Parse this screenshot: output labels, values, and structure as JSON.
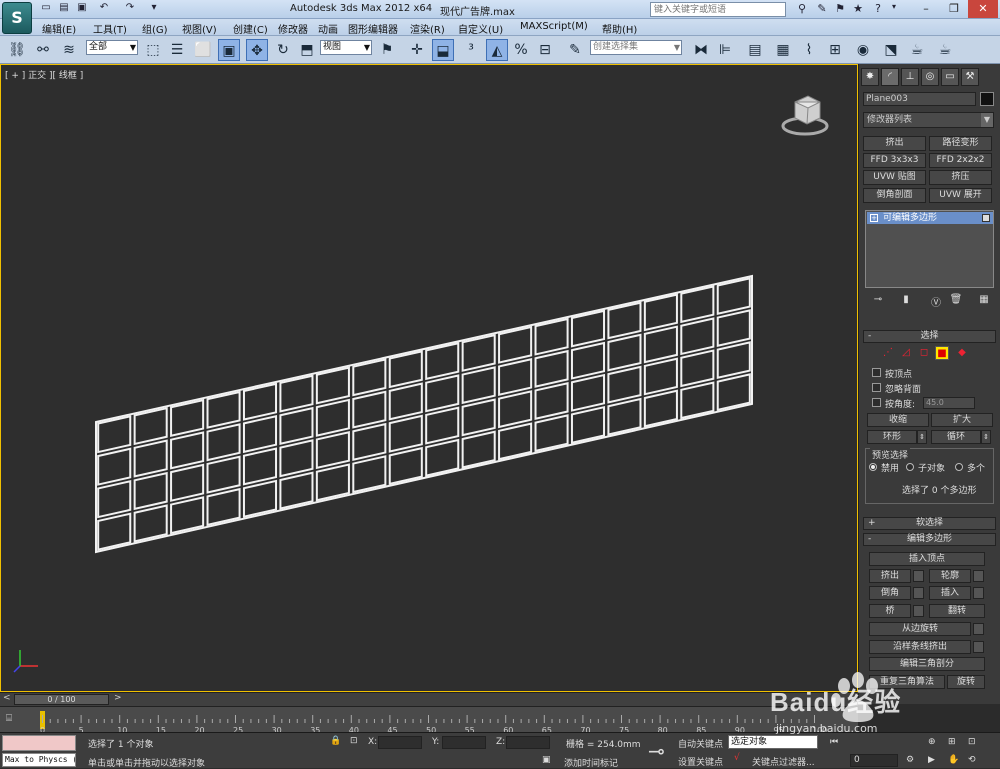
{
  "title": {
    "app": "Autodesk 3ds Max  2012 x64",
    "file": "现代广告牌.max",
    "search_placeholder": "键入关键字或短语"
  },
  "menu": [
    "编辑(E)",
    "工具(T)",
    "组(G)",
    "视图(V)",
    "创建(C)",
    "修改器",
    "动画",
    "图形编辑器",
    "渲染(R)",
    "自定义(U)",
    "MAXScript(M)",
    "帮助(H)"
  ],
  "toolbar": {
    "selection_filter": "全部",
    "ref_coord": "视图",
    "named_selection": "创建选择集"
  },
  "viewport": {
    "label": "[ + ] 正交 ][ 线框 ]"
  },
  "panel": {
    "object_name": "Plane003",
    "modifier_list": "修改器列表",
    "mod_buttons": [
      "挤出",
      "路径变形",
      "FFD 3x3x3",
      "FFD 2x2x2",
      "UVW 贴图",
      "挤压",
      "倒角剖面",
      "UVW 展开"
    ],
    "stack_item": "可编辑多边形",
    "selection_title": "选择",
    "by_vertex": "按顶点",
    "ignore_backfacing": "忽略背面",
    "by_angle": "按角度:",
    "angle_value": "45.0",
    "shrink": "收缩",
    "grow": "扩大",
    "ring": "环形",
    "loop": "循环",
    "preview_title": "预览选择",
    "preview_options": [
      "禁用",
      "子对象",
      "多个"
    ],
    "selection_status": "选择了 0 个多边形",
    "soft_selection": "软选择",
    "edit_poly": "编辑多边形",
    "insert_vertex": "插入顶点",
    "extrude": "挤出",
    "outline": "轮廓",
    "bevel": "倒角",
    "inset": "插入",
    "bridge": "桥",
    "flip": "翻转",
    "hinge": "从边旋转",
    "extrude_spline": "沿样条线挤出",
    "edit_tri": "编辑三角剖分",
    "retriangulate": "重复三角算法",
    "turn": "旋转"
  },
  "timeslider": {
    "frame": "0 / 100"
  },
  "trackbar": {
    "ticks": [
      "0",
      "5",
      "10",
      "15",
      "20",
      "25",
      "30",
      "35",
      "40",
      "45",
      "50",
      "55",
      "60",
      "65",
      "70",
      "75",
      "80",
      "85",
      "90",
      "95",
      "100"
    ]
  },
  "status": {
    "maxscript_output": "Max to Physcs (",
    "selected": "选择了 1 个对象",
    "prompt": "单击或单击并拖动以选择对象",
    "x_label": "X:",
    "y_label": "Y:",
    "z_label": "Z:",
    "grid": "栅格 = 254.0mm",
    "add_time_tag": "添加时间标记",
    "auto_key": "自动关键点",
    "set_key": "设置关键点",
    "key_mode": "选定对象",
    "key_filters": "关键点过滤器...",
    "frame_value": "0"
  },
  "watermark": {
    "brand": "Baidu经验",
    "url": "jingyan.baidu.com"
  }
}
